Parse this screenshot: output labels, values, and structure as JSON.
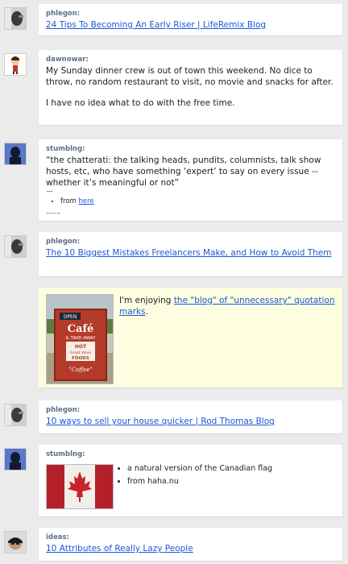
{
  "posts": [
    {
      "user": "phlegon:",
      "link": "24 Tips To Becoming An Early Riser | LifeRemix Blog"
    },
    {
      "user": "dawnowar:",
      "paragraph1": "My Sunday dinner crew is out of town this weekend. No dice to throw, no random restaurant to visit, no movie and snacks for after.",
      "paragraph2": "I have no idea what to do with the free time."
    },
    {
      "user": "stumblng:",
      "quote": "“the chatterati: the talking heads, pundits, columnists, talk show hosts, etc, who have something ‘expert’ to say on every issue -- whether it’s meaningful or not”",
      "dash": "—",
      "from_label": "from",
      "from_link": "here",
      "trailing": "––––"
    },
    {
      "user": "phlegon:",
      "link": "The 10 Biggest Mistakes Freelancers Make, and How to Avoid Them"
    },
    {
      "text_before": "I'm enjoying",
      "link": "the \"blog\" of \"unnecessary\" quotation marks",
      "text_after": ".",
      "sign": {
        "open": "OPEN",
        "cafe": "Café",
        "take_away": "& TAKE-AWAY",
        "hot": "HOT",
        "great": "Great Value",
        "foods": "FOODS",
        "coffee": "\"Coffee\""
      }
    },
    {
      "user": "phlegon:",
      "link": "10 ways to sell your house quicker | Rod Thomas Blog"
    },
    {
      "user": "stumblng:",
      "bullets": [
        "a natural version of the Canadian flag",
        "from haha.nu"
      ]
    },
    {
      "user": "ideas:",
      "link": "10 Attributes of Really Lazy People"
    }
  ],
  "colors": {
    "link": "#1b58d8",
    "username": "#5f6f86",
    "highlight": "#fdfde0",
    "background": "#ebebeb"
  }
}
